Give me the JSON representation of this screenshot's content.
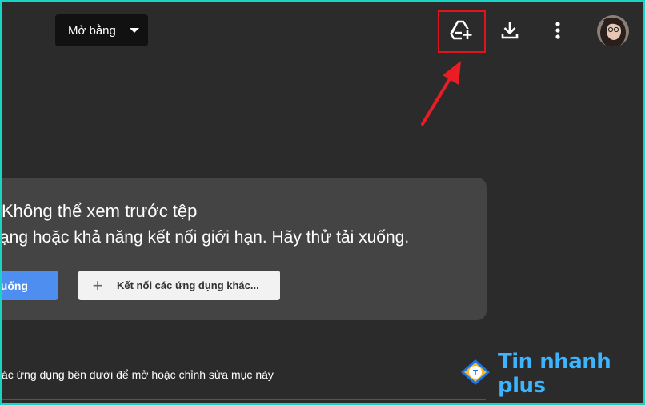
{
  "toolbar": {
    "open_with_label": "Mở bằng",
    "icons": [
      "add-to-drive-icon",
      "download-icon",
      "more-vert-icon"
    ]
  },
  "card": {
    "title": "Không thể xem trước tệp",
    "subtitle": "ạng hoặc khả năng kết nối giới hạn. Hãy thử tải xuống.",
    "download_label": "uống",
    "connect_label": "Kết nối các ứng dụng khác..."
  },
  "apps_hint": "ác ứng dụng bên dưới để mở hoặc chỉnh sửa mục này",
  "watermark": {
    "text": "Tin nhanh plus"
  },
  "colors": {
    "background": "#2b2b2b",
    "card": "#444444",
    "primary_button": "#4d8ef0",
    "highlight_box": "#e0141b",
    "frame": "#19d3c5",
    "brand": "#3db4ff"
  }
}
